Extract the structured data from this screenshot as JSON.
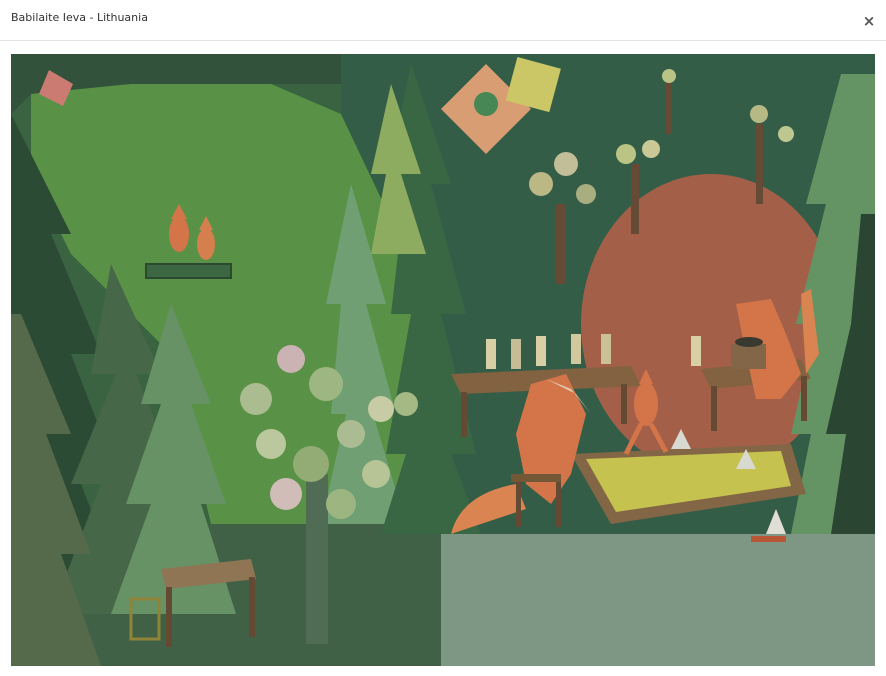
{
  "modal": {
    "title": "Babilaite Ieva - Lithuania",
    "close_icon": "close-icon",
    "close_glyph": "×"
  },
  "artwork": {
    "subject": "illustration-foxes-in-forest",
    "palette": {
      "meadow": "#5f9c4a",
      "forest_dark": "#2f5239",
      "tree_light": "#74a86c",
      "fox": "#e27a4c",
      "sun": "#c8654f",
      "floor": "#8aa692",
      "sandbox": "#d4cf54",
      "wood": "#6a4a35"
    }
  }
}
